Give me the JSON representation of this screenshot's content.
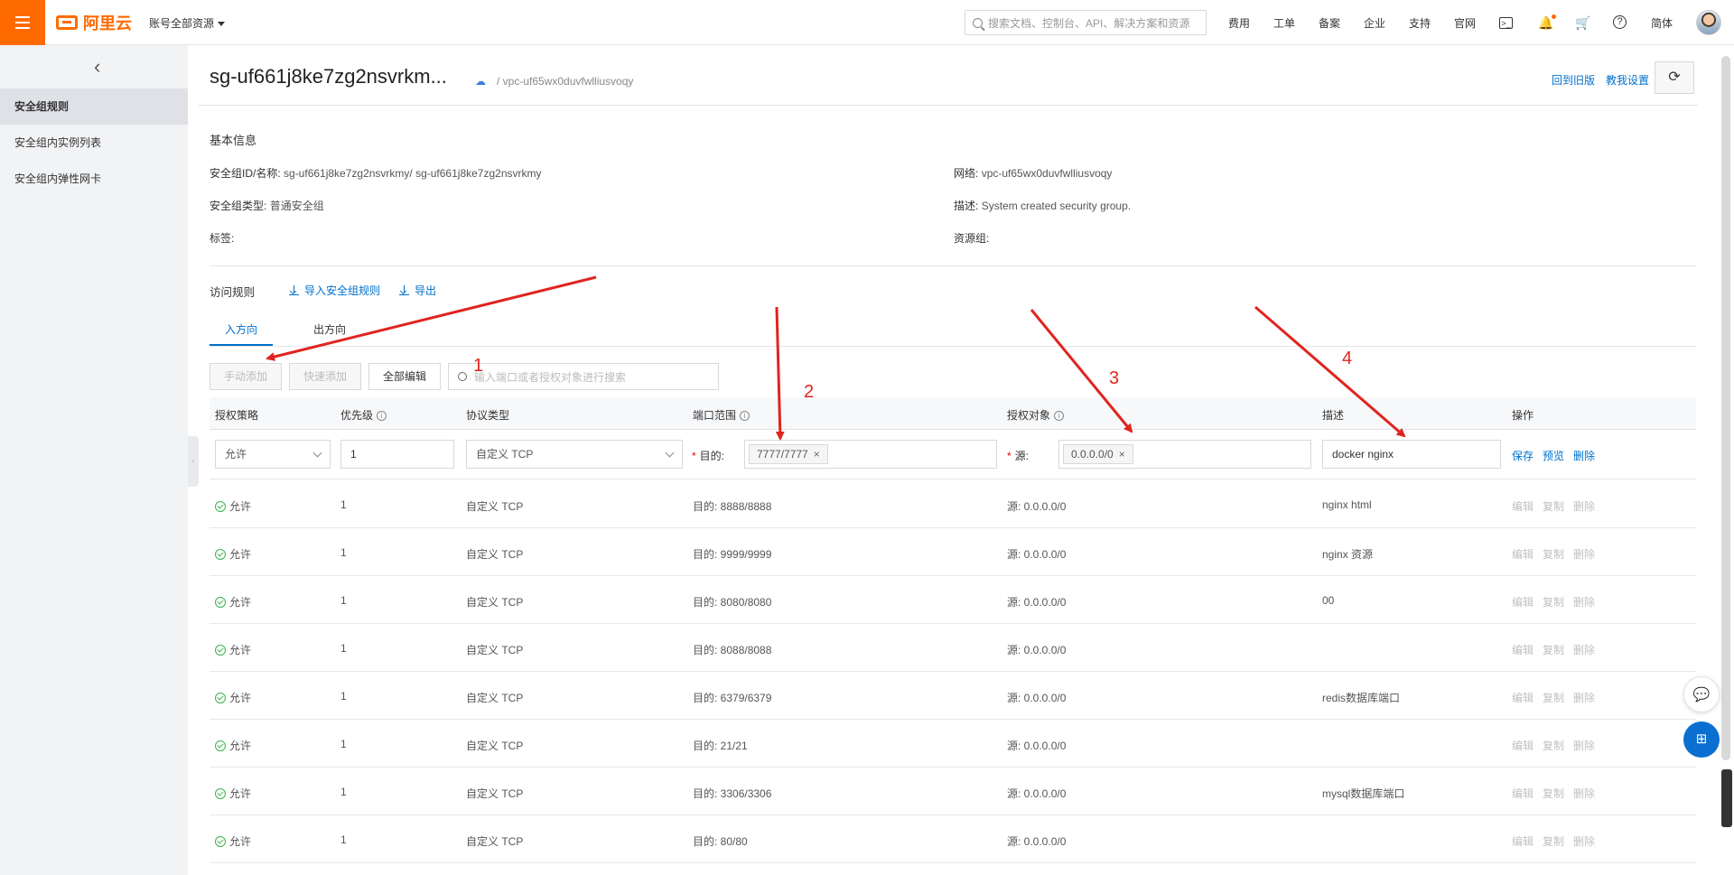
{
  "header": {
    "brand": "阿里云",
    "account_menu": "账号全部资源",
    "search_placeholder": "搜索文档、控制台、API、解决方案和资源",
    "nav": [
      "费用",
      "工单",
      "备案",
      "企业",
      "支持",
      "官网"
    ],
    "lang": "简体"
  },
  "sidebar": {
    "items": [
      {
        "label": "安全组规则",
        "active": true
      },
      {
        "label": "安全组内实例列表"
      },
      {
        "label": "安全组内弹性网卡"
      }
    ]
  },
  "page": {
    "title": "sg-uf661j8ke7zg2nsvrkm...",
    "vpc_crumb": "/ vpc-uf65wx0duvfwlliusvoqy",
    "link_old": "回到旧版",
    "link_setting": "教我设置",
    "basic_title": "基本信息",
    "info": {
      "id_label": "安全组ID/名称:",
      "id_value": "sg-uf661j8ke7zg2nsvrkmy/ sg-uf661j8ke7zg2nsvrkmy",
      "type_label": "安全组类型:",
      "type_value": "普通安全组",
      "tag_label": "标签:",
      "net_label": "网络:",
      "net_value": "vpc-uf65wx0duvfwlliusvoqy",
      "desc_label": "描述:",
      "desc_value": "System created security group.",
      "rg_label": "资源组:"
    },
    "rules_title": "访问规则",
    "import_label": "导入安全组规则",
    "export_label": "导出",
    "tab_in": "入方向",
    "tab_out": "出方向",
    "btn_manual": "手动添加",
    "btn_quick": "快速添加",
    "btn_edit_all": "全部编辑",
    "rule_search_placeholder": "输入端口或者授权对象进行搜索"
  },
  "table": {
    "headers": {
      "policy": "授权策略",
      "priority": "优先级",
      "protocol": "协议类型",
      "port": "端口范围",
      "target": "授权对象",
      "desc": "描述",
      "action": "操作"
    },
    "edit_row": {
      "policy": "允许",
      "priority": "1",
      "protocol": "自定义 TCP",
      "dest_label": "目的:",
      "port_tag": "7777/7777",
      "src_label": "源:",
      "src_tag": "0.0.0.0/0",
      "desc": "docker nginx",
      "save": "保存",
      "preview": "预览",
      "delete": "删除"
    },
    "ops": {
      "edit": "编辑",
      "copy": "复制",
      "delete": "删除"
    },
    "rows": [
      {
        "policy": "允许",
        "priority": "1",
        "protocol": "自定义 TCP",
        "port": "目的: 8888/8888",
        "source": "源: 0.0.0.0/0",
        "desc": "nginx html"
      },
      {
        "policy": "允许",
        "priority": "1",
        "protocol": "自定义 TCP",
        "port": "目的: 9999/9999",
        "source": "源: 0.0.0.0/0",
        "desc": "nginx 资源"
      },
      {
        "policy": "允许",
        "priority": "1",
        "protocol": "自定义 TCP",
        "port": "目的: 8080/8080",
        "source": "源: 0.0.0.0/0",
        "desc": "00"
      },
      {
        "policy": "允许",
        "priority": "1",
        "protocol": "自定义 TCP",
        "port": "目的: 8088/8088",
        "source": "源: 0.0.0.0/0",
        "desc": ""
      },
      {
        "policy": "允许",
        "priority": "1",
        "protocol": "自定义 TCP",
        "port": "目的: 6379/6379",
        "source": "源: 0.0.0.0/0",
        "desc": "redis数据库端口"
      },
      {
        "policy": "允许",
        "priority": "1",
        "protocol": "自定义 TCP",
        "port": "目的: 21/21",
        "source": "源: 0.0.0.0/0",
        "desc": ""
      },
      {
        "policy": "允许",
        "priority": "1",
        "protocol": "自定义 TCP",
        "port": "目的: 3306/3306",
        "source": "源: 0.0.0.0/0",
        "desc": "mysql数据库端口"
      },
      {
        "policy": "允许",
        "priority": "1",
        "protocol": "自定义 TCP",
        "port": "目的: 80/80",
        "source": "源: 0.0.0.0/0",
        "desc": ""
      }
    ]
  },
  "annotations": {
    "n1": "1",
    "n2": "2",
    "n3": "3",
    "n4": "4",
    "arrow_color": "#e0241f"
  }
}
